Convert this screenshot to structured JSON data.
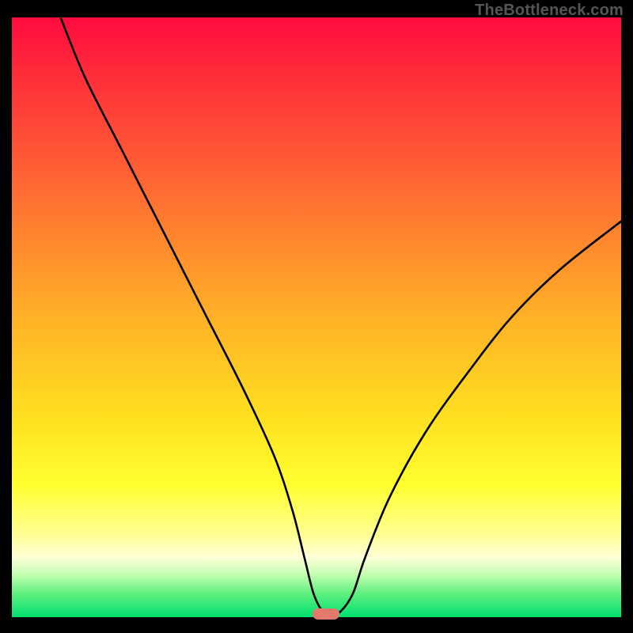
{
  "watermark": "TheBottleneck.com",
  "colors": {
    "curve_stroke": "#000000",
    "marker_fill": "#e47a6c",
    "frame_bg": "#000000"
  },
  "chart_data": {
    "type": "line",
    "title": "",
    "xlabel": "",
    "ylabel": "",
    "xlim": [
      0,
      100
    ],
    "ylim": [
      0,
      100
    ],
    "grid": false,
    "series": [
      {
        "name": "bottleneck-curve",
        "x": [
          8,
          12,
          18,
          25,
          32,
          38,
          43,
          46,
          48,
          49.5,
          51,
          52.5,
          54,
          56,
          58,
          62,
          68,
          75,
          82,
          90,
          100
        ],
        "y": [
          100,
          90,
          78,
          64,
          50,
          38,
          27,
          18,
          10,
          4,
          1,
          0.5,
          1,
          4,
          10,
          20,
          31,
          41,
          50,
          58,
          66
        ]
      }
    ],
    "marker": {
      "x": 51.5,
      "y": 0.5
    },
    "note": "x/y are percentages of the visible plot area; y=0 is bottom"
  }
}
